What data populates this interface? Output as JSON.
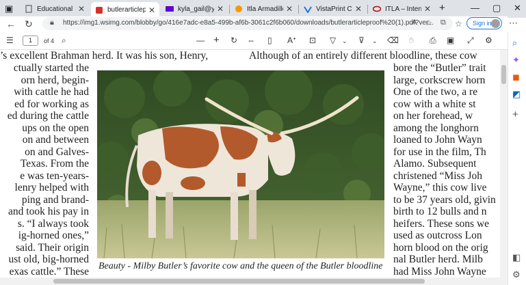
{
  "tabs": [
    {
      "title": "Educational",
      "favicon": "document-icon",
      "color": "#5f6368"
    },
    {
      "title": "butlerarticleproof",
      "favicon": "pdf-icon",
      "color": "#d93025",
      "active": true
    },
    {
      "title": "kyla_gail@yahoo.",
      "favicon": "yahoo-mail-icon",
      "color": "#6001d2"
    },
    {
      "title": "Itla Armadillo Clas",
      "favicon": "itla-icon",
      "color": "#f29900"
    },
    {
      "title": "VistaPrint Cart",
      "favicon": "vistaprint-icon",
      "color": "#1a73e8"
    },
    {
      "title": "ITLA – Internation",
      "favicon": "itla-globe-icon",
      "color": "#b31412"
    }
  ],
  "address": {
    "url": "https://img1.wsimg.com/blobby/go/416e7adc-e8a5-499b-af6b-3061c2f6b060/downloads/butlerarticleproof%20(1).pdf?ver...",
    "signin_label": "Sign in"
  },
  "pdf_toolbar": {
    "page_number": "1",
    "page_count": "of 4"
  },
  "article": {
    "top_left": "’s excellent Brahman herd. It was his son, Henry,",
    "top_right": "Although of an entirely different bloodline, these cow",
    "left_column": [
      "ctually started the",
      "orn herd, begin-",
      "with cattle he had",
      "ed for working as",
      "ed during the cattle",
      "ups on the open",
      "on and between",
      "on and Galves-",
      "Texas. From the",
      "e was ten-years-",
      "lenry helped with",
      "ping and brand-",
      "and took his pay in",
      "s. “I always took",
      "ig-horned ones,”",
      "said. Their origin",
      "ust old, big-horned",
      "exas cattle.” These"
    ],
    "right_column": [
      "bore the “Butler” trait",
      "large, corkscrew horn",
      "One of the two, a re",
      "cow with a white st",
      "on her forehead, w",
      "among the longhorn",
      "loaned to John Wayn",
      "for use in the film, Th",
      "Alamo. Subsequent",
      "christened “Miss Joh",
      "Wayne,” this cow live",
      "to be 37 years old, givin",
      "birth to 12 bulls and n",
      "heifers. These sons we",
      "used as outcross Lon",
      "horn blood on the orig",
      "nal Butler herd. Milb",
      "had Miss John Wayne"
    ],
    "caption": "Beauty - Milby Butler’s favorite cow and the queen of the Butler bloodline"
  },
  "colors": {
    "accent": "#1a73e8",
    "tabstrip": "#dfe3e8"
  }
}
